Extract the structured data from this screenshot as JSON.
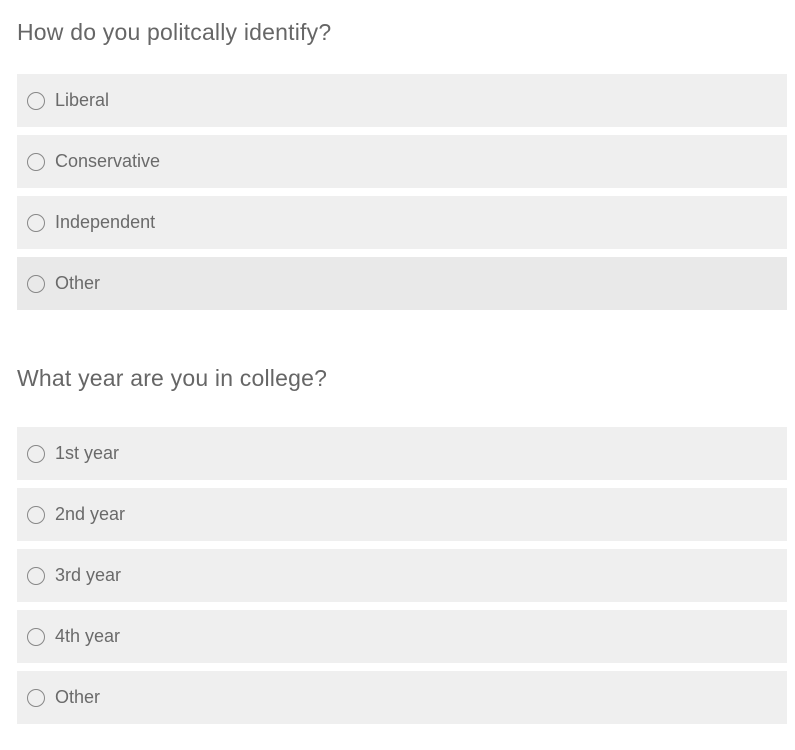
{
  "questions": [
    {
      "title": "How do you politcally identify?",
      "options": [
        {
          "label": "Liberal",
          "selected": false
        },
        {
          "label": "Conservative",
          "selected": false
        },
        {
          "label": "Independent",
          "selected": false
        },
        {
          "label": "Other",
          "selected": false
        }
      ]
    },
    {
      "title": "What year are you in college?",
      "options": [
        {
          "label": "1st year",
          "selected": false
        },
        {
          "label": "2nd year",
          "selected": false
        },
        {
          "label": "3rd year",
          "selected": false
        },
        {
          "label": "4th year",
          "selected": false
        },
        {
          "label": "Other",
          "selected": false
        }
      ]
    }
  ],
  "colors": {
    "option_bg": "#efefef",
    "option_bg_hover": "#e9e9e9",
    "text": "#666666",
    "radio_border": "#888888"
  },
  "icons": {
    "radio": "radio-unchecked-icon"
  }
}
